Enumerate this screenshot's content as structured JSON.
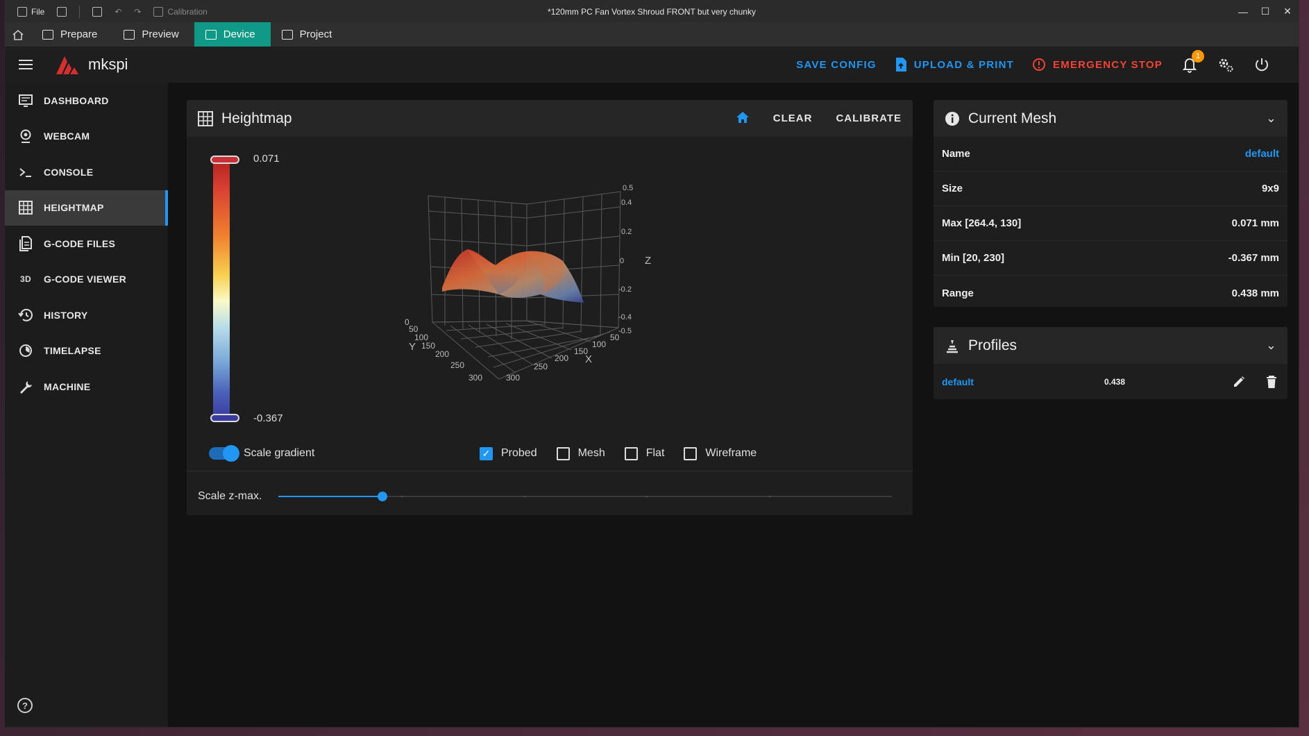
{
  "titlebar": {
    "file": "File",
    "calibration": "Calibration",
    "title": "*120mm PC Fan Vortex Shroud FRONT but very chunky"
  },
  "tabs": [
    {
      "label": "Prepare",
      "icon": "cube-icon"
    },
    {
      "label": "Preview",
      "icon": "layers-icon"
    },
    {
      "label": "Device",
      "icon": "device-icon",
      "active": true
    },
    {
      "label": "Project",
      "icon": "project-icon"
    }
  ],
  "appbar": {
    "brand": "mkspi",
    "save_config": "SAVE CONFIG",
    "upload_print": "UPLOAD & PRINT",
    "emergency_stop": "EMERGENCY STOP",
    "notification_count": "1"
  },
  "sidebar": {
    "items": [
      {
        "label": "DASHBOARD",
        "icon": "dashboard-icon"
      },
      {
        "label": "WEBCAM",
        "icon": "webcam-icon"
      },
      {
        "label": "CONSOLE",
        "icon": "console-icon"
      },
      {
        "label": "HEIGHTMAP",
        "icon": "grid-icon",
        "active": true
      },
      {
        "label": "G-CODE FILES",
        "icon": "files-icon"
      },
      {
        "label": "G-CODE VIEWER",
        "icon": "3d-icon"
      },
      {
        "label": "HISTORY",
        "icon": "history-icon"
      },
      {
        "label": "TIMELAPSE",
        "icon": "timelapse-icon"
      },
      {
        "label": "MACHINE",
        "icon": "wrench-icon"
      }
    ],
    "icon_3d_text": "3D"
  },
  "heightmap": {
    "title": "Heightmap",
    "clear": "CLEAR",
    "calibrate": "CALIBRATE",
    "scale_max": "0.071",
    "scale_min": "-0.367",
    "scale_gradient_label": "Scale gradient",
    "scale_gradient_on": true,
    "checkboxes": [
      {
        "label": "Probed",
        "checked": true
      },
      {
        "label": "Mesh",
        "checked": false
      },
      {
        "label": "Flat",
        "checked": false
      },
      {
        "label": "Wireframe",
        "checked": false
      }
    ],
    "scale_zmax_label": "Scale z-max.",
    "scale_zmax_fraction": 0.17,
    "axes": {
      "z_ticks": [
        "0.5",
        "0.4",
        "0.2",
        "0",
        "-0.2",
        "-0.4"
      ],
      "z_label": "Z",
      "x_ticks": [
        "50",
        "100",
        "150",
        "200",
        "250",
        "300"
      ],
      "x_label": "X",
      "y_ticks": [
        "0",
        "50",
        "100",
        "150",
        "200",
        "250",
        "300"
      ],
      "y_label": "Y",
      "extra_x": "-0.5"
    }
  },
  "current_mesh": {
    "title": "Current Mesh",
    "rows": [
      {
        "label": "Name",
        "value": "default",
        "link": true
      },
      {
        "label": "Size",
        "value": "9x9"
      },
      {
        "label": "Max [264.4, 130]",
        "value": "0.071 mm"
      },
      {
        "label": "Min [20, 230]",
        "value": "-0.367 mm"
      },
      {
        "label": "Range",
        "value": "0.438 mm"
      }
    ]
  },
  "profiles": {
    "title": "Profiles",
    "items": [
      {
        "name": "default",
        "value": "0.438"
      }
    ]
  },
  "colors": {
    "accent": "#2196f3",
    "teal_tab": "#0e9a86",
    "danger": "#f44336",
    "badge": "#ff9800"
  }
}
